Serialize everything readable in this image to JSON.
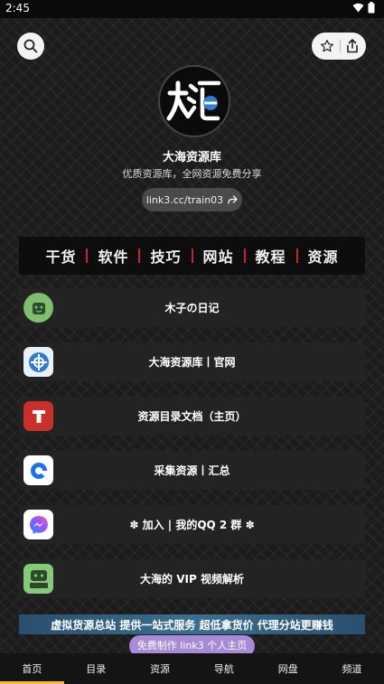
{
  "status": {
    "time": "2:45"
  },
  "profile": {
    "name": "大海资源库",
    "bio": "优质资源库，全网资源免费分享",
    "link": "link3.cc/train03"
  },
  "banner": {
    "items": [
      "干货",
      "软件",
      "技巧",
      "网站",
      "教程",
      "资源"
    ]
  },
  "links": [
    {
      "label": "木子の日记",
      "icon": "muzi-diary-icon"
    },
    {
      "label": "大海资源库丨官网",
      "icon": "dahai-logo-icon"
    },
    {
      "label": "资源目录文档（主页）",
      "icon": "document-t-icon"
    },
    {
      "label": "采集资源丨汇总",
      "icon": "collection-icon"
    },
    {
      "label": "✽ 加入 | 我的QQ 2 群 ✽",
      "icon": "messenger-icon"
    },
    {
      "label": "大海的 VIP 视频解析",
      "icon": "muzi-video-icon"
    }
  ],
  "ad": {
    "text": "虚拟货源总站 提供一站式服务 超低拿货价 代理分站更赚钱"
  },
  "float_button": {
    "label": "免费制作 link3 个人主页"
  },
  "tabs": [
    "首页",
    "目录",
    "资源",
    "导航",
    "网盘",
    "频道"
  ],
  "colors": {
    "accent": "#f2c230",
    "banner_divider": "#c0282e",
    "float": "#a88ad6"
  }
}
